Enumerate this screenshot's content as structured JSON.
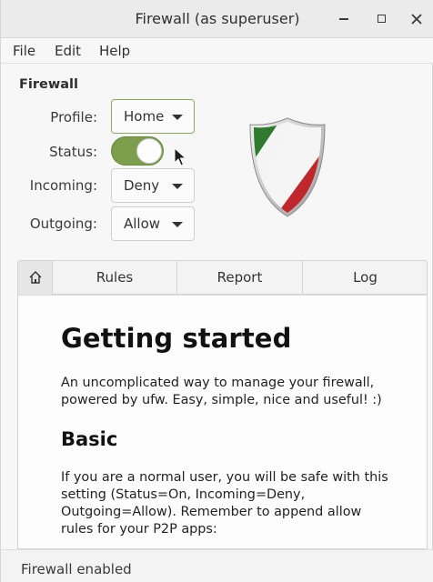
{
  "window": {
    "title": "Firewall (as superuser)"
  },
  "menu": {
    "file": "File",
    "edit": "Edit",
    "help": "Help"
  },
  "firewall": {
    "section_title": "Firewall",
    "profile_label": "Profile:",
    "profile_value": "Home",
    "status_label": "Status:",
    "status_on": true,
    "incoming_label": "Incoming:",
    "incoming_value": "Deny",
    "outgoing_label": "Outgoing:",
    "outgoing_value": "Allow"
  },
  "tabs": {
    "home_icon": "home-icon",
    "rules": "Rules",
    "report": "Report",
    "log": "Log"
  },
  "content": {
    "heading": "Getting started",
    "intro_line1": "An uncomplicated way to manage your firewall,",
    "intro_line2": "powered by ufw. Easy, simple, nice and useful! :)",
    "basic_heading": "Basic",
    "basic_line1": "If you are a normal user, you will be safe with this",
    "basic_line2": "setting (Status=On, Incoming=Deny,",
    "basic_line3": "Outgoing=Allow). Remember to append allow",
    "basic_line4": "rules for your P2P apps:"
  },
  "statusbar": {
    "text": "Firewall enabled"
  },
  "colors": {
    "switch_on": "#7d9e4c",
    "shield_green": "#2f7a2f",
    "shield_red": "#c0272d"
  }
}
